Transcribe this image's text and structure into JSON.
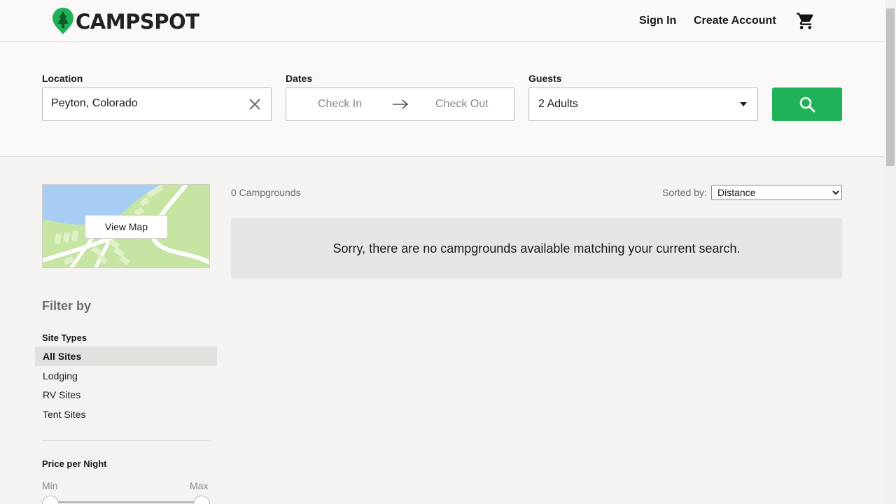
{
  "header": {
    "brand": "CAMPSPOT",
    "logo_icon": "tree-pin-icon",
    "sign_in": "Sign In",
    "create_account": "Create Account",
    "cart_icon": "shopping-cart-icon"
  },
  "search": {
    "location_label": "Location",
    "location_value": "Peyton, Colorado",
    "clear_icon": "close-icon",
    "dates_label": "Dates",
    "check_in": "Check In",
    "check_out": "Check Out",
    "arrow_icon": "arrow-right-icon",
    "guests_label": "Guests",
    "guests_value": "2 Adults",
    "search_icon": "search-icon",
    "button_color": "#20b258"
  },
  "sidebar": {
    "view_map": "View Map",
    "filter_by": "Filter by",
    "site_types_title": "Site Types",
    "site_types": [
      {
        "label": "All Sites",
        "active": true
      },
      {
        "label": "Lodging",
        "active": false
      },
      {
        "label": "RV Sites",
        "active": false
      },
      {
        "label": "Tent Sites",
        "active": false
      }
    ],
    "price_title": "Price per Night",
    "price_min": "Min",
    "price_max": "Max"
  },
  "results": {
    "count": "0 Campgrounds",
    "sorted_by": "Sorted by:",
    "sort_selected": "Distance",
    "empty_message": "Sorry, there are no campgrounds available matching your current search."
  }
}
